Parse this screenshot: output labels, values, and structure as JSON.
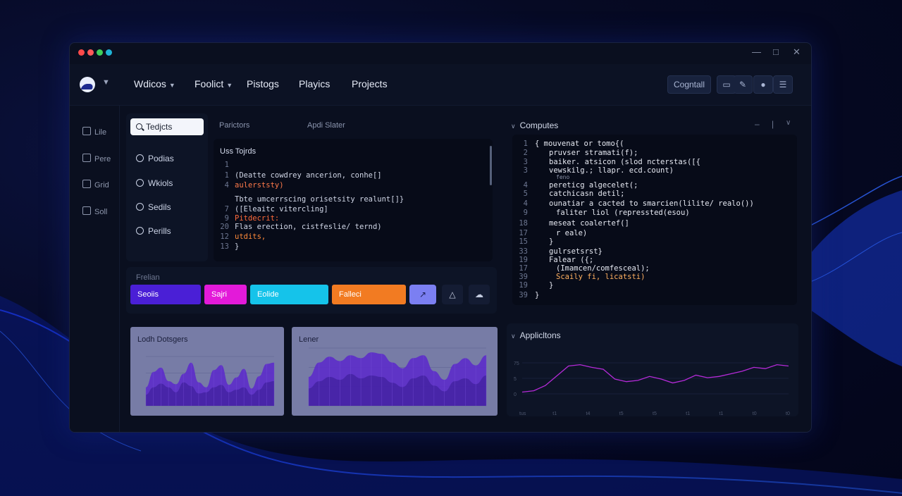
{
  "navbar": {
    "items": [
      {
        "label": "Wdicos",
        "dropdown": true
      },
      {
        "label": "Foolict",
        "dropdown": true
      },
      {
        "label": "Pistogs",
        "dropdown": false
      },
      {
        "label": "Playics",
        "dropdown": false
      },
      {
        "label": "Projects",
        "dropdown": false
      }
    ],
    "primary_button": "Cogntall"
  },
  "sidebar": {
    "items": [
      {
        "label": "Lile",
        "icon": "folder-icon"
      },
      {
        "label": "Pere",
        "icon": "file-icon"
      },
      {
        "label": "Grid",
        "icon": "grid-icon"
      },
      {
        "label": "Soll",
        "icon": "terminal-icon"
      }
    ]
  },
  "left_nav": {
    "search_value": "Tedjcts",
    "items": [
      {
        "label": "Podias",
        "icon": "pods-icon"
      },
      {
        "label": "Wkiols",
        "icon": "globe-icon"
      },
      {
        "label": "Sedils",
        "icon": "stack-icon"
      },
      {
        "label": "Perills",
        "icon": "box-icon"
      }
    ]
  },
  "editor": {
    "tabs": [
      "Parictors",
      "Apdi Slater"
    ],
    "title": "Uss Tojrds",
    "lines": [
      {
        "n": "1",
        "text": ""
      },
      {
        "n": "1",
        "text": "(Deatte cowdrey ancerion, conhe[]"
      },
      {
        "n": "4",
        "text": "aulerststy)"
      },
      {
        "n": "",
        "text": ""
      },
      {
        "n": "",
        "text": "Tbte umcerrscing orisetsity realunt[]}"
      },
      {
        "n": "7",
        "text": "([Eleaitc vitercling]"
      },
      {
        "n": "9",
        "text": "Pitdecrit:"
      },
      {
        "n": "20",
        "text": "Flas erection, cistfeslie/ ternd)"
      },
      {
        "n": "12",
        "text": "utdits,"
      },
      {
        "n": "13",
        "text": "}"
      }
    ]
  },
  "actions": {
    "label": "Frelian",
    "buttons": [
      {
        "label": "Seoiis",
        "color": "#4a1fd6"
      },
      {
        "label": "Sajri",
        "color": "#e31ad9"
      },
      {
        "label": "Eolide",
        "color": "#15c3ea"
      },
      {
        "label": "Falleci",
        "color": "#f27b22"
      }
    ],
    "icon_buttons": [
      "share-icon",
      "bell-icon",
      "cloud-icon"
    ]
  },
  "computes": {
    "title": "Computes",
    "lines": [
      {
        "n": "1",
        "text": "{ mouvenat or tomo{("
      },
      {
        "n": "2",
        "text": "pruvser stramati(f);"
      },
      {
        "n": "3",
        "text": "baiker. atsicon (slod ncterstas([{"
      },
      {
        "n": "3",
        "text": "vewskilg.; llapr. ecd.count)"
      },
      {
        "n": "",
        "text": "feno"
      },
      {
        "n": "4",
        "text": "pereticg algecelet(;"
      },
      {
        "n": "5",
        "text": "catchicasn detil;"
      },
      {
        "n": "4",
        "text": "ounatiar a cacted to smarcien(lilite/ realo())"
      },
      {
        "n": "9",
        "text": "faliter liol (repressted(esou)"
      },
      {
        "n": "18",
        "text": "meseat coalertef(]"
      },
      {
        "n": "17",
        "text": "r eale)"
      },
      {
        "n": "15",
        "text": "}"
      },
      {
        "n": "33",
        "text": "gulrsetsrst}"
      },
      {
        "n": "19",
        "text": "Falear ({;"
      },
      {
        "n": "17",
        "text": "(Imamcen/comfesceal);"
      },
      {
        "n": "39",
        "text": "Scaily fi, licatsti)"
      },
      {
        "n": "19",
        "text": "}"
      },
      {
        "n": "39",
        "text": "}"
      }
    ]
  },
  "chart_cards": [
    {
      "title": "Lodh Dotsgers"
    },
    {
      "title": "Lener"
    }
  ],
  "applications": {
    "title": "Applicltons",
    "x_ticks": [
      "tus",
      "t1",
      "t4",
      "t5",
      "t5",
      "t1",
      "t1",
      "t0",
      "t0"
    ],
    "y_ticks": [
      "75",
      "5",
      "0"
    ]
  },
  "chart_data": [
    {
      "type": "area",
      "title": "Lodh Dotsgers",
      "values": [
        30,
        55,
        62,
        40,
        35,
        52,
        70,
        38,
        30,
        58,
        66,
        34,
        46,
        60,
        28,
        48,
        68,
        70
      ],
      "values2": [
        18,
        30,
        36,
        30,
        22,
        38,
        32,
        20,
        22,
        30,
        34,
        22,
        26,
        30,
        18,
        26,
        38,
        40
      ]
    },
    {
      "type": "area",
      "title": "Lener",
      "values": [
        40,
        60,
        68,
        62,
        70,
        66,
        74,
        72,
        60,
        52,
        66,
        70,
        48,
        36,
        58,
        66,
        56,
        70
      ],
      "values2": [
        24,
        34,
        40,
        36,
        44,
        38,
        42,
        40,
        32,
        26,
        38,
        42,
        28,
        20,
        34,
        38,
        30,
        42
      ]
    },
    {
      "type": "line",
      "title": "Applicltons",
      "values": [
        20,
        22,
        30,
        45,
        60,
        62,
        58,
        55,
        40,
        36,
        38,
        44,
        40,
        34,
        38,
        46,
        42,
        44,
        48,
        52,
        58,
        56,
        62,
        60
      ]
    }
  ]
}
